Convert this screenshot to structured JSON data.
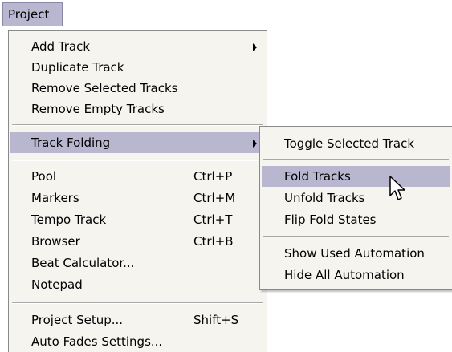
{
  "menubar": {
    "project_label": "Project"
  },
  "main_menu": {
    "add_track": "Add Track",
    "duplicate_track": "Duplicate Track",
    "remove_selected_tracks": "Remove Selected Tracks",
    "remove_empty_tracks": "Remove Empty Tracks",
    "track_folding": "Track Folding",
    "pool": {
      "label": "Pool",
      "shortcut": "Ctrl+P"
    },
    "markers": {
      "label": "Markers",
      "shortcut": "Ctrl+M"
    },
    "tempo_track": {
      "label": "Tempo Track",
      "shortcut": "Ctrl+T"
    },
    "browser": {
      "label": "Browser",
      "shortcut": "Ctrl+B"
    },
    "beat_calculator": "Beat Calculator...",
    "notepad": "Notepad",
    "project_setup": {
      "label": "Project Setup...",
      "shortcut": "Shift+S"
    },
    "auto_fades_settings": "Auto Fades Settings..."
  },
  "sub_menu": {
    "toggle_selected_track": "Toggle Selected Track",
    "fold_tracks": "Fold Tracks",
    "unfold_tracks": "Unfold Tracks",
    "flip_fold_states": "Flip Fold States",
    "show_used_automation": "Show Used Automation",
    "hide_all_automation": "Hide All Automation"
  },
  "colors": {
    "highlight": "#b9b7d0",
    "menu_bg": "#f5f4ef"
  },
  "icons": {
    "submenu": "chevron-right-icon",
    "cursor": "mouse-pointer-icon"
  }
}
